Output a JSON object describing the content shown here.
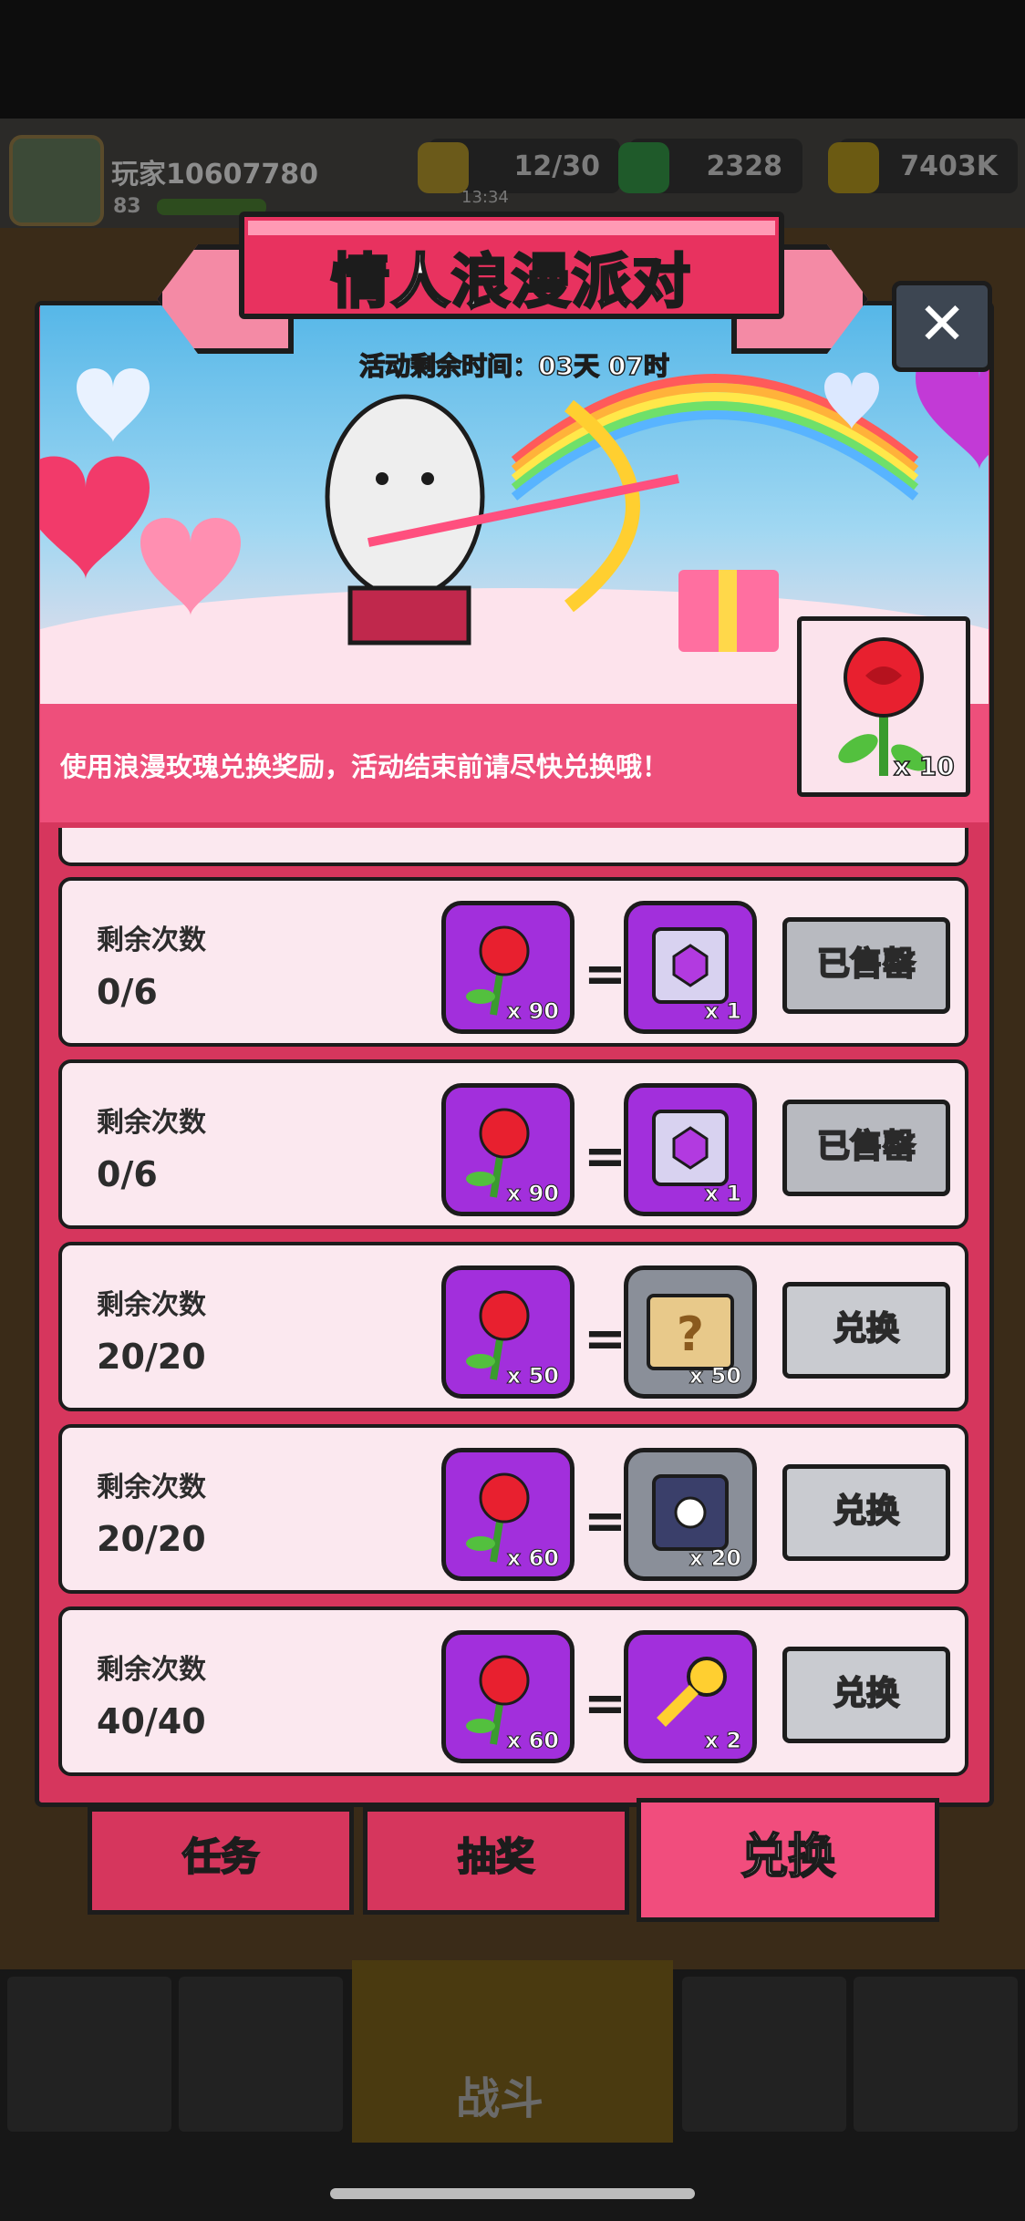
{
  "hud": {
    "player_name": "玩家10607780",
    "player_level": "83",
    "energy": "12/30",
    "energy_timer": "13:34",
    "gems": "2328",
    "coins": "7403K"
  },
  "event": {
    "title": "情人浪漫派对",
    "timer": "活动剩余时间：03天 07时",
    "instruction": "使用浪漫玫瑰兑换奖励，活动结束前请尽快兑换哦！",
    "rose_count": "x 10",
    "close_icon": "close-icon"
  },
  "exchange_rows": [
    {
      "label": "剩余次数",
      "count": "0/6",
      "cost": "x 90",
      "reward_icon": "hand-chest-icon",
      "reward_qty": "x 1",
      "button": "已售罄",
      "sold_out": true
    },
    {
      "label": "剩余次数",
      "count": "0/6",
      "cost": "x 90",
      "reward_icon": "shield-chest-icon",
      "reward_qty": "x 1",
      "button": "已售罄",
      "sold_out": true
    },
    {
      "label": "剩余次数",
      "count": "20/20",
      "cost": "x 50",
      "reward_icon": "mystery-scroll-icon",
      "reward_qty": "x 50",
      "button": "兑换",
      "sold_out": false
    },
    {
      "label": "剩余次数",
      "count": "20/20",
      "cost": "x 60",
      "reward_icon": "gear-chest-icon",
      "reward_qty": "x 20",
      "button": "兑换",
      "sold_out": false
    },
    {
      "label": "剩余次数",
      "count": "40/40",
      "cost": "x 60",
      "reward_icon": "golden-key-icon",
      "reward_qty": "x 2",
      "button": "兑换",
      "sold_out": false
    }
  ],
  "tabs": [
    {
      "label": "任务",
      "active": false
    },
    {
      "label": "抽奖",
      "active": false
    },
    {
      "label": "兑换",
      "active": true
    }
  ],
  "bottom_nav": {
    "battle_label": "战斗"
  },
  "colors": {
    "panel_pink": "#d6365d",
    "purple_item": "#a22fdc",
    "row_bg": "#fbe8ef"
  }
}
